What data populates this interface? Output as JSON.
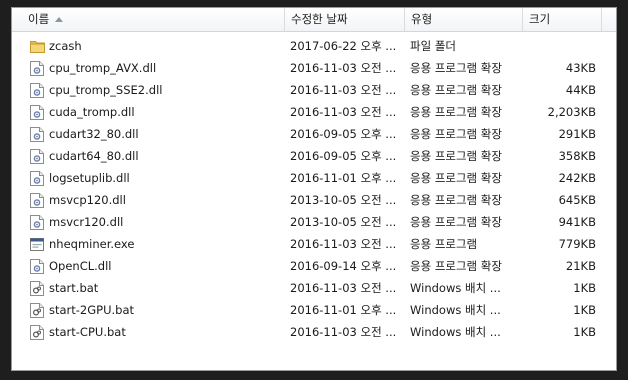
{
  "columns": {
    "name": "이름",
    "date": "수정한 날짜",
    "type": "유형",
    "size": "크기"
  },
  "files": [
    {
      "icon": "folder-icon",
      "name": "zcash",
      "date": "2017-06-22 오후 ...",
      "type": "파일 폴더",
      "size": ""
    },
    {
      "icon": "dll-file-icon",
      "name": "cpu_tromp_AVX.dll",
      "date": "2016-11-03 오전 ...",
      "type": "응용 프로그램 확장",
      "size": "43KB"
    },
    {
      "icon": "dll-file-icon",
      "name": "cpu_tromp_SSE2.dll",
      "date": "2016-11-03 오전 ...",
      "type": "응용 프로그램 확장",
      "size": "44KB"
    },
    {
      "icon": "dll-file-icon",
      "name": "cuda_tromp.dll",
      "date": "2016-11-03 오전 ...",
      "type": "응용 프로그램 확장",
      "size": "2,203KB"
    },
    {
      "icon": "dll-file-icon",
      "name": "cudart32_80.dll",
      "date": "2016-09-05 오후 ...",
      "type": "응용 프로그램 확장",
      "size": "291KB"
    },
    {
      "icon": "dll-file-icon",
      "name": "cudart64_80.dll",
      "date": "2016-09-05 오후 ...",
      "type": "응용 프로그램 확장",
      "size": "358KB"
    },
    {
      "icon": "dll-file-icon",
      "name": "logsetuplib.dll",
      "date": "2016-11-01 오후 ...",
      "type": "응용 프로그램 확장",
      "size": "242KB"
    },
    {
      "icon": "dll-file-icon",
      "name": "msvcp120.dll",
      "date": "2013-10-05 오전 ...",
      "type": "응용 프로그램 확장",
      "size": "645KB"
    },
    {
      "icon": "dll-file-icon",
      "name": "msvcr120.dll",
      "date": "2013-10-05 오전 ...",
      "type": "응용 프로그램 확장",
      "size": "941KB"
    },
    {
      "icon": "exe-file-icon",
      "name": "nheqminer.exe",
      "date": "2016-11-03 오전 ...",
      "type": "응용 프로그램",
      "size": "779KB"
    },
    {
      "icon": "dll-file-icon",
      "name": "OpenCL.dll",
      "date": "2016-09-14 오후 ...",
      "type": "응용 프로그램 확장",
      "size": "21KB"
    },
    {
      "icon": "bat-file-icon",
      "name": "start.bat",
      "date": "2016-11-03 오전 ...",
      "type": "Windows 배치 ...",
      "size": "1KB"
    },
    {
      "icon": "bat-file-icon",
      "name": "start-2GPU.bat",
      "date": "2016-11-01 오후 ...",
      "type": "Windows 배치 ...",
      "size": "1KB"
    },
    {
      "icon": "bat-file-icon",
      "name": "start-CPU.bat",
      "date": "2016-11-03 오전 ...",
      "type": "Windows 배치 ...",
      "size": "1KB"
    }
  ],
  "colors": {
    "folder": "#e8c15a",
    "file_border": "#8c8c8c",
    "gear": "#6b7fa8",
    "exe_bar": "#3a5a8c"
  }
}
